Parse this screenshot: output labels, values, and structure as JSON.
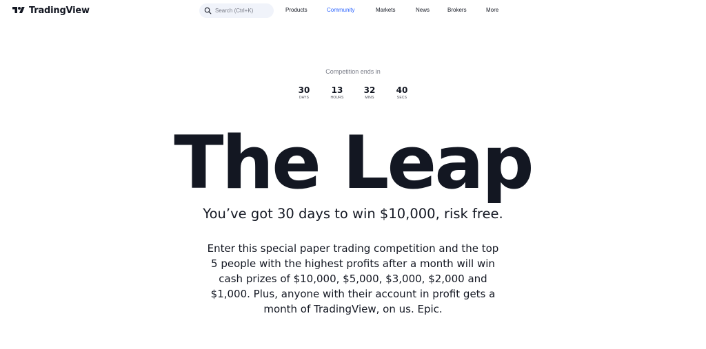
{
  "header": {
    "logo_text": "TradingView",
    "search_placeholder": "Search (Ctrl+K)",
    "nav": [
      "Products",
      "Community",
      "Markets",
      "News",
      "Brokers",
      "More"
    ],
    "active_nav": "Community",
    "accent_color": "#2962ff"
  },
  "countdown": {
    "label": "Competition ends in",
    "days": "30",
    "days_label": "DAYS",
    "hours": "13",
    "hours_label": "HOURS",
    "mins": "32",
    "mins_label": "MINS",
    "secs": "40",
    "secs_label": "SECS"
  },
  "hero": {
    "title": "The Leap",
    "subtitle": "You’ve got 30 days to win $10,000, risk free.",
    "body": "Enter this special paper trading competition and the top 5 people with the highest profits after a month will win cash prizes of $10,000, $5,000, $3,000, $2,000 and $1,000. Plus, anyone with their account in profit gets a month of TradingView, on us. Epic."
  }
}
